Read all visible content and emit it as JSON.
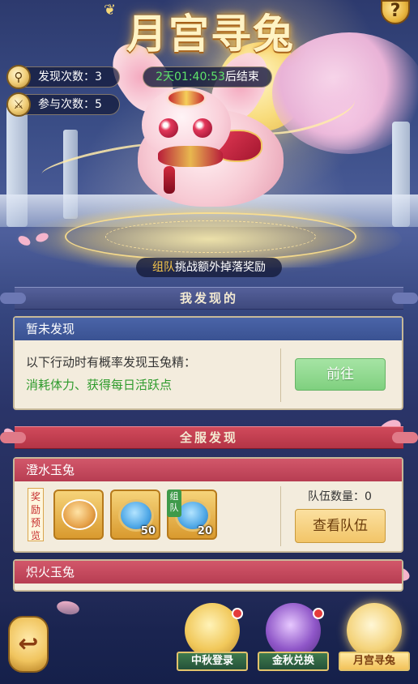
{
  "title": "月宫寻兔",
  "stats": {
    "found_label": "发现次数：",
    "found_value": "3",
    "joined_label": "参与次数：",
    "joined_value": "5"
  },
  "timer": {
    "countdown": "2天01:40:53",
    "suffix": "后结束"
  },
  "team_bonus": {
    "highlight": "组队",
    "text": "挑战额外掉落奖励"
  },
  "my_found": {
    "banner": "我发现的",
    "header": "暂未发现",
    "desc": "以下行动时有概率发现玉兔精：",
    "desc_green": "消耗体力、获得每日活跃点",
    "go_button": "前往"
  },
  "server_found": {
    "banner": "全服发现",
    "rabbits": [
      {
        "name": "澄水玉兔",
        "reward_tag": "奖励预览",
        "team_label": "队伍数量：",
        "team_count": "0",
        "view_button": "查看队伍",
        "rewards": [
          {
            "icon": "mooncake-icon",
            "count": ""
          },
          {
            "icon": "jade-token-icon",
            "count": "50"
          },
          {
            "icon": "jade-token-icon",
            "count": "20",
            "badge": "组队"
          }
        ]
      },
      {
        "name": "炽火玉兔"
      }
    ]
  },
  "nav": {
    "back": "back-arrow-icon",
    "items": [
      {
        "label": "中秋登录",
        "icon": "moon-rabbit-icon",
        "active": false,
        "dot": true
      },
      {
        "label": "金秋兑换",
        "icon": "treasure-bag-icon",
        "active": false,
        "dot": true
      },
      {
        "label": "月宫寻兔",
        "icon": "rabbit-icon",
        "active": true,
        "dot": false
      }
    ]
  },
  "help": "?"
}
